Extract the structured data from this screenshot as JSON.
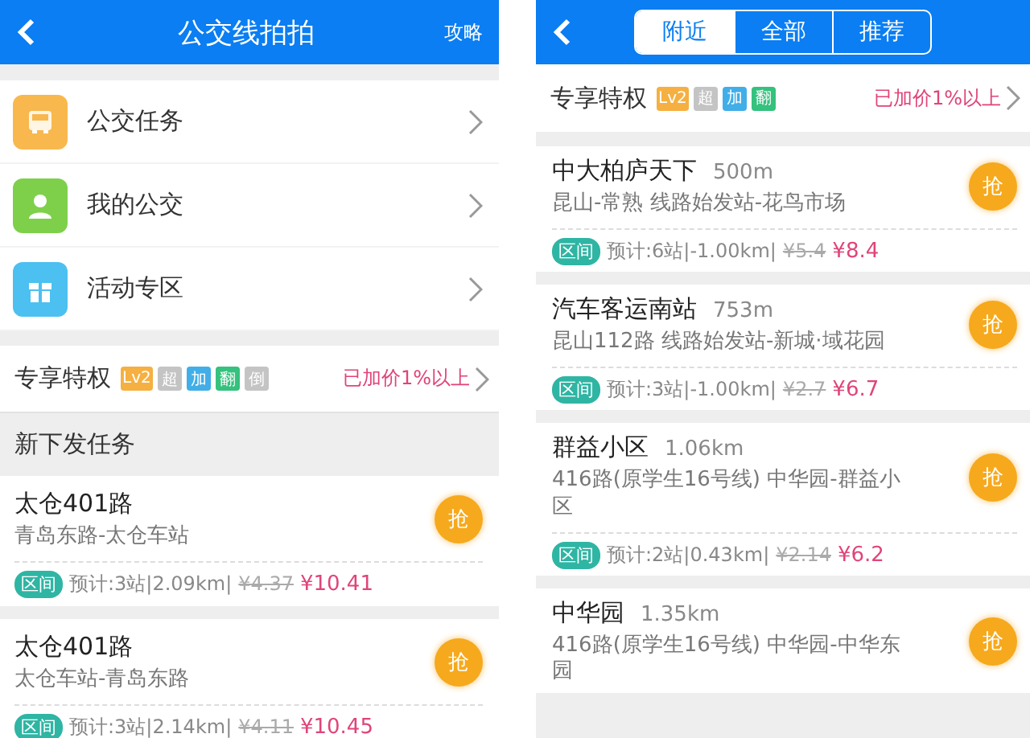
{
  "left_screen": {
    "header": {
      "title": "公交线拍拍",
      "action": "攻略"
    },
    "menu": [
      {
        "kind": "bus",
        "label": "公交任务",
        "color": "#f8b84e"
      },
      {
        "kind": "person",
        "label": "我的公交",
        "color": "#7ed04b"
      },
      {
        "kind": "gift",
        "label": "活动专区",
        "color": "#4cc0f0"
      }
    ],
    "privilege": {
      "label": "专享特权",
      "badges": [
        {
          "text": "Lv2",
          "color": "#f5b041"
        },
        {
          "text": "超",
          "color": "#c4c4c4"
        },
        {
          "text": "加",
          "color": "#42aee8"
        },
        {
          "text": "翻",
          "color": "#35c17e"
        },
        {
          "text": "倒",
          "color": "#c4c4c4"
        }
      ],
      "note": "已加价1%以上"
    },
    "section_title": "新下发任务",
    "tasks": [
      {
        "route": "太仓401路",
        "stops": "青岛东路-太仓车站",
        "tag": "区间",
        "estimate": "预计:3站|2.09km|",
        "old_price": "¥4.37",
        "new_price": "¥10.41",
        "grab": "抢"
      },
      {
        "route": "太仓401路",
        "stops": "太仓车站-青岛东路",
        "tag": "区间",
        "estimate": "预计:3站|2.14km|",
        "old_price": "¥4.11",
        "new_price": "¥10.45",
        "grab": "抢"
      }
    ]
  },
  "right_screen": {
    "tabs": [
      {
        "label": "附近",
        "selected": true
      },
      {
        "label": "全部",
        "selected": false
      },
      {
        "label": "推荐",
        "selected": false
      }
    ],
    "privilege": {
      "label": "专享特权",
      "badges": [
        {
          "text": "Lv2",
          "color": "#f5b041"
        },
        {
          "text": "超",
          "color": "#c4c4c4"
        },
        {
          "text": "加",
          "color": "#42aee8"
        },
        {
          "text": "翻",
          "color": "#35c17e"
        }
      ],
      "note": "已加价1%以上"
    },
    "nearby": [
      {
        "name": "中大柏庐天下",
        "distance": "500m",
        "line": "昆山-常熟 线路始发站-花鸟市场",
        "tag": "区间",
        "estimate": "预计:6站|-1.00km|",
        "old_price": "¥5.4",
        "new_price": "¥8.4",
        "grab": "抢"
      },
      {
        "name": "汽车客运南站",
        "distance": "753m",
        "line": "昆山112路 线路始发站-新城·域花园",
        "tag": "区间",
        "estimate": "预计:3站|-1.00km|",
        "old_price": "¥2.7",
        "new_price": "¥6.7",
        "grab": "抢"
      },
      {
        "name": "群益小区",
        "distance": "1.06km",
        "line": "416路(原学生16号线) 中华园-群益小区",
        "tag": "区间",
        "estimate": "预计:2站|0.43km|",
        "old_price": "¥2.14",
        "new_price": "¥6.2",
        "grab": "抢"
      },
      {
        "name": "中华园",
        "distance": "1.35km",
        "line": "416路(原学生16号线) 中华园-中华东园",
        "grab": "抢"
      }
    ]
  }
}
